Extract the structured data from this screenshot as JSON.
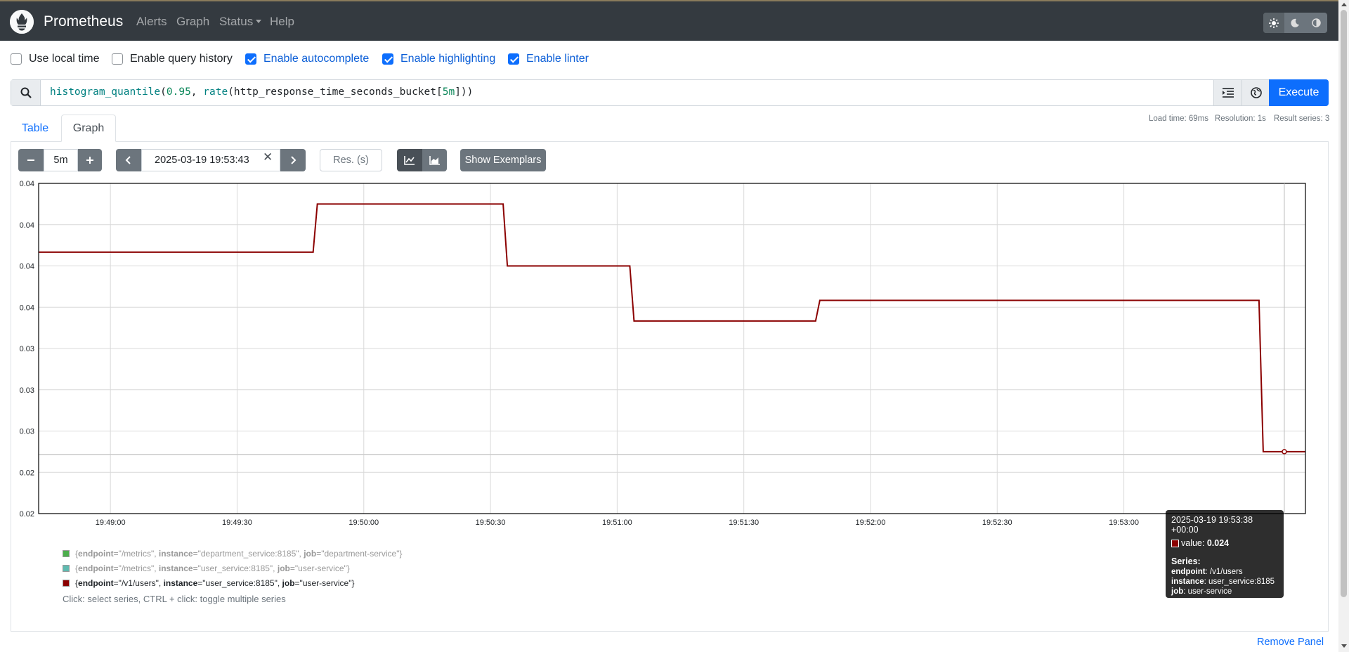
{
  "navbar": {
    "brand": "Prometheus",
    "links": [
      "Alerts",
      "Graph",
      "Status",
      "Help"
    ],
    "theme_icons": [
      "sun-icon",
      "moon-icon",
      "contrast-icon"
    ]
  },
  "options": {
    "use_local_time": {
      "label": "Use local time",
      "checked": false
    },
    "query_history": {
      "label": "Enable query history",
      "checked": false
    },
    "autocomplete": {
      "label": "Enable autocomplete",
      "checked": true
    },
    "highlighting": {
      "label": "Enable highlighting",
      "checked": true
    },
    "linter": {
      "label": "Enable linter",
      "checked": true
    }
  },
  "expression": {
    "query": "histogram_quantile(0.95, rate(http_response_time_seconds_bucket[5m]))",
    "tokens": [
      {
        "t": "histogram_quantile",
        "k": "fn"
      },
      {
        "t": "(",
        "k": "id"
      },
      {
        "t": "0.95",
        "k": "num"
      },
      {
        "t": ", ",
        "k": "id"
      },
      {
        "t": "rate",
        "k": "fn"
      },
      {
        "t": "(http_response_time_seconds_bucket[",
        "k": "id"
      },
      {
        "t": "5m",
        "k": "num"
      },
      {
        "t": "]))",
        "k": "id"
      }
    ],
    "execute_label": "Execute"
  },
  "stats": {
    "load_time": "Load time: 69ms",
    "resolution": "Resolution: 1s",
    "result_series": "Result series: 3"
  },
  "tabs": {
    "table": "Table",
    "graph": "Graph"
  },
  "controls": {
    "range": "5m",
    "end_time": "2025-03-19 19:53:43",
    "res_placeholder": "Res. (s)",
    "show_exemplars": "Show Exemplars"
  },
  "chart_data": {
    "type": "line",
    "y_tick_labels": [
      "0.04",
      "0.04",
      "0.04",
      "0.04",
      "0.03",
      "0.03",
      "0.03",
      "0.02",
      "0.02"
    ],
    "y_range": [
      0.02,
      0.044
    ],
    "x_tick_labels": [
      "19:49:00",
      "19:49:30",
      "19:50:00",
      "19:50:30",
      "19:51:00",
      "19:51:30",
      "19:52:00",
      "19:52:30",
      "19:53:00"
    ],
    "x_range_seconds_after_19_48_43": [
      0,
      300
    ],
    "grid": true,
    "series": [
      {
        "name": "{endpoint=\"/v1/users\", instance=\"user_service:8185\", job=\"user-service\"}",
        "color": "#8b0000",
        "x": [
          0,
          65,
          66,
          110,
          111,
          140,
          141,
          184,
          185,
          289,
          290,
          300
        ],
        "y": [
          0.039,
          0.039,
          0.0425,
          0.0425,
          0.038,
          0.038,
          0.034,
          0.034,
          0.0355,
          0.0355,
          0.0245,
          0.0245
        ]
      },
      {
        "name": "{endpoint=\"/metrics\", instance=\"user_service:8185\", job=\"user-service\"}",
        "color": "#cccccc",
        "x": [
          0,
          300
        ],
        "y": [
          0.0243,
          0.0243
        ]
      }
    ]
  },
  "tooltip": {
    "time": "2025-03-19 19:53:38 +00:00",
    "value_label": "value:",
    "value": "0.024",
    "series_heading": "Series:",
    "labels": [
      {
        "k": "endpoint",
        "v": ": /v1/users"
      },
      {
        "k": "instance",
        "v": ": user_service:8185"
      },
      {
        "k": "job",
        "v": ": user-service"
      }
    ]
  },
  "legend": {
    "items": [
      {
        "endpoint": "/metrics",
        "instance": "department_service:8185",
        "job": "department-service",
        "color": "#4cae4c",
        "active": false
      },
      {
        "endpoint": "/metrics",
        "instance": "user_service:8185",
        "job": "user-service",
        "color": "#5fbab0",
        "active": false
      },
      {
        "endpoint": "/v1/users",
        "instance": "user_service:8185",
        "job": "user-service",
        "color": "#8b0000",
        "active": true
      }
    ],
    "hint": "Click: select series, CTRL + click: toggle multiple series"
  },
  "remove_panel": "Remove Panel"
}
